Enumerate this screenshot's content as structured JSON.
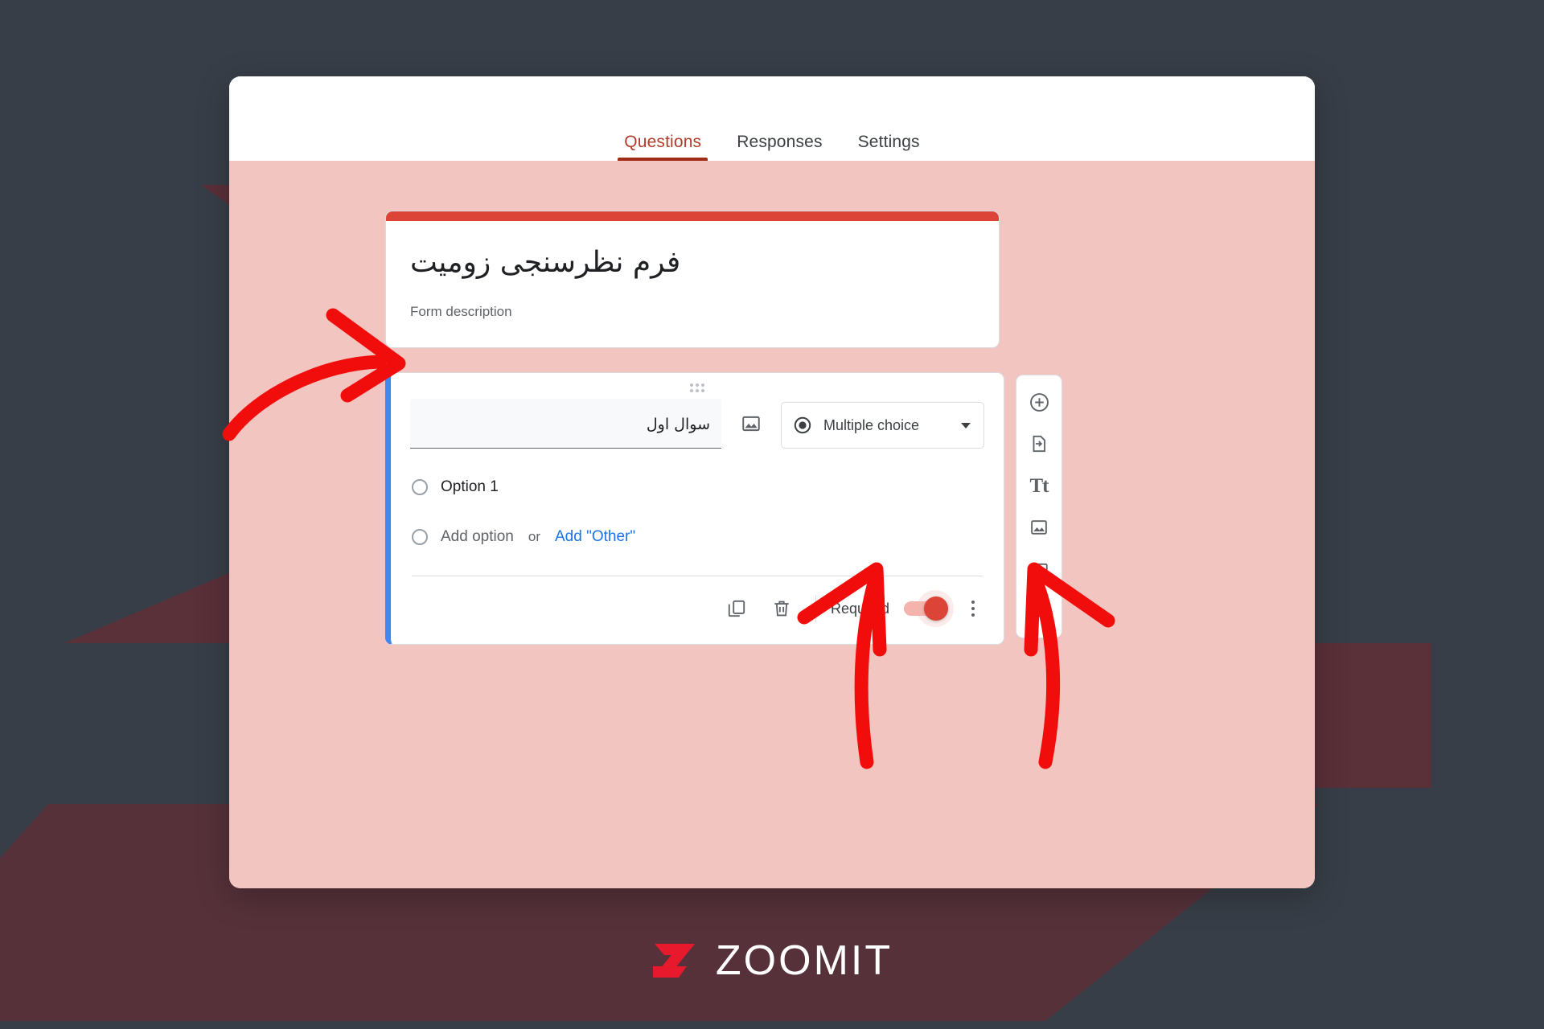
{
  "page": {
    "background_color": "#383e47",
    "watermark_color": "#5a3039"
  },
  "browser": {
    "canvas_color": "#f2c5c0",
    "accent_color": "#db4437",
    "selected_card_border_color": "#4285f4"
  },
  "tabs": [
    {
      "label": "Questions",
      "active": true,
      "name": "tab-questions"
    },
    {
      "label": "Responses",
      "active": false,
      "name": "tab-responses"
    },
    {
      "label": "Settings",
      "active": false,
      "name": "tab-settings"
    }
  ],
  "form": {
    "title": "فرم نظرسنجی زومیت",
    "description": "Form description"
  },
  "question": {
    "title_value": "سوال اول",
    "type_label": "Multiple choice",
    "type_icon": "radio-button-icon",
    "dropdown_icon": "chevron-down-icon",
    "image_icon": "image-icon",
    "drag_handle_icon": "drag-handle-icon",
    "options": [
      {
        "label": "Option 1",
        "kind": "option"
      }
    ],
    "add_option_label": "Add option",
    "or_label": "or",
    "add_other_label": "Add \"Other\"",
    "footer": {
      "duplicate_icon": "duplicate-icon",
      "delete_icon": "trash-icon",
      "required_label": "Required",
      "required_on": true,
      "more_icon": "more-vertical-icon"
    }
  },
  "side_toolbar": [
    {
      "name": "add-question-button",
      "icon": "plus-circle-icon"
    },
    {
      "name": "import-questions-button",
      "icon": "import-file-icon"
    },
    {
      "name": "add-title-description-button",
      "icon": "text-title-icon",
      "glyph": "Tt"
    },
    {
      "name": "add-image-button",
      "icon": "image-icon"
    },
    {
      "name": "add-video-button",
      "icon": "video-icon"
    },
    {
      "name": "add-section-button",
      "icon": "section-icon"
    }
  ],
  "annotations": {
    "arrow_color": "#f20d0d",
    "arrows": [
      {
        "name": "arrow-to-question-title",
        "points_at": "question-title-input"
      },
      {
        "name": "arrow-to-card-footer",
        "points_at": "card-footer-actions"
      },
      {
        "name": "arrow-to-required-toggle",
        "points_at": "required-toggle"
      }
    ]
  },
  "footer": {
    "brand": "ZOOMIT",
    "mark_color": "#e8192c"
  }
}
